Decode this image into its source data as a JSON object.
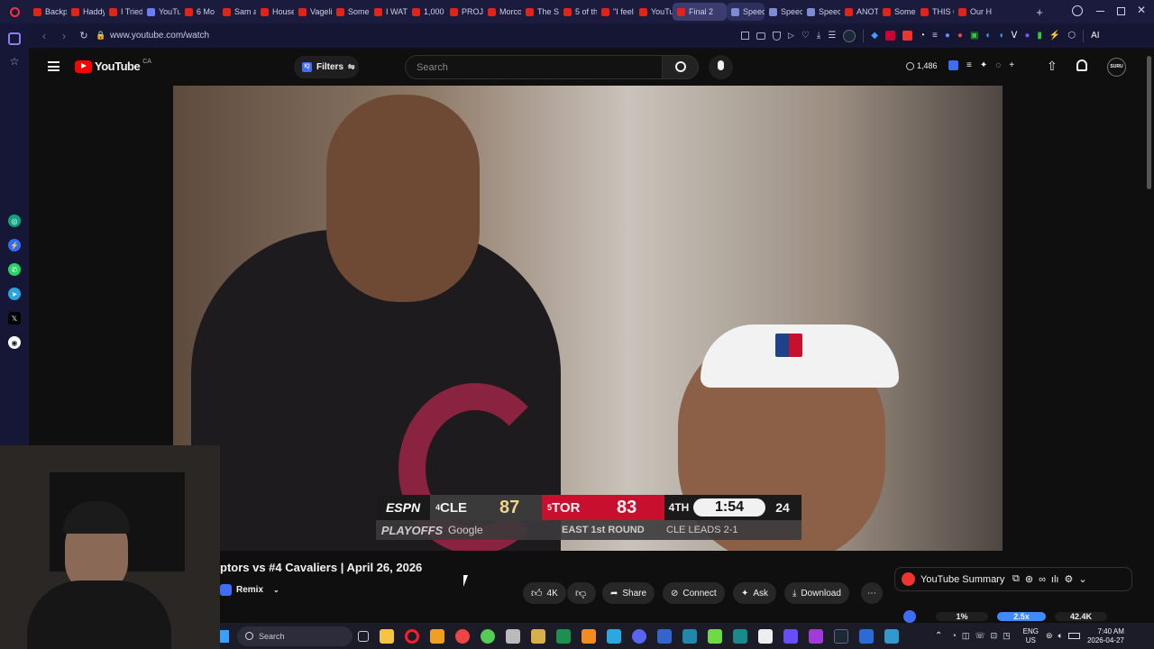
{
  "tabs": [
    {
      "label": "Backp",
      "color": "#e62117"
    },
    {
      "label": "Haddy",
      "color": "#e62117"
    },
    {
      "label": "I Tried",
      "color": "#e62117"
    },
    {
      "label": "YouTu",
      "color": "#6a7cff"
    },
    {
      "label": "6 Mo",
      "color": "#e62117"
    },
    {
      "label": "Sam a",
      "color": "#e62117"
    },
    {
      "label": "House",
      "color": "#e62117"
    },
    {
      "label": "Vageli",
      "color": "#e62117"
    },
    {
      "label": "Some",
      "color": "#e62117"
    },
    {
      "label": "I WAT",
      "color": "#e62117"
    },
    {
      "label": "1,000",
      "color": "#e62117"
    },
    {
      "label": "PROJE",
      "color": "#e62117"
    },
    {
      "label": "Morco",
      "color": "#e62117"
    },
    {
      "label": "The Sc",
      "color": "#e62117"
    },
    {
      "label": "5 of th",
      "color": "#e62117"
    },
    {
      "label": "\"I feel",
      "color": "#e62117"
    },
    {
      "label": "YouTu",
      "color": "#e62117"
    },
    {
      "label": "Final 2",
      "color": "#e62117",
      "active": true
    },
    {
      "label": "Speec",
      "color": "#7d8bd6",
      "speed": true
    },
    {
      "label": "Speec",
      "color": "#7d8bd6"
    },
    {
      "label": "Speec",
      "color": "#7d8bd6"
    },
    {
      "label": "ANOT",
      "color": "#e62117"
    },
    {
      "label": "Some",
      "color": "#e62117"
    },
    {
      "label": "THIS C",
      "color": "#e62117"
    },
    {
      "label": "Our H",
      "color": "#e62117"
    }
  ],
  "address": {
    "url": "www.youtube.com/watch"
  },
  "addr_right": {
    "ai": "AI"
  },
  "yt": {
    "logo": "YouTube",
    "region": "CA",
    "filters": "Filters",
    "search_placeholder": "Search",
    "view_count": "1,486",
    "avatar": "SURU"
  },
  "scorebug": {
    "network": "ESPN",
    "away_seed": "4",
    "away_team": "CLE",
    "away_score": "87",
    "home_seed": "5",
    "home_team": "TOR",
    "home_score": "83",
    "quarter": "4TH",
    "clock": "1:54",
    "shot_clock": "24",
    "brand": "PLAYOFFS",
    "sponsor": "Google",
    "series": "EAST 1st ROUND",
    "series_status": "CLE LEADS 2-1"
  },
  "video": {
    "title": "ptors vs #4 Cavaliers | April 26, 2026",
    "remix": "Remix",
    "likes": "4K",
    "share": "Share",
    "connect": "Connect",
    "ask": "Ask",
    "download": "Download"
  },
  "summary": {
    "label": "YouTube Summary",
    "pct": "1%",
    "speed": "2.5x",
    "count": "42.4K"
  },
  "taskbar": {
    "search": "Search",
    "lang1": "ENG",
    "lang2": "US",
    "time": "7:40 AM",
    "date": "2026-04-27"
  }
}
